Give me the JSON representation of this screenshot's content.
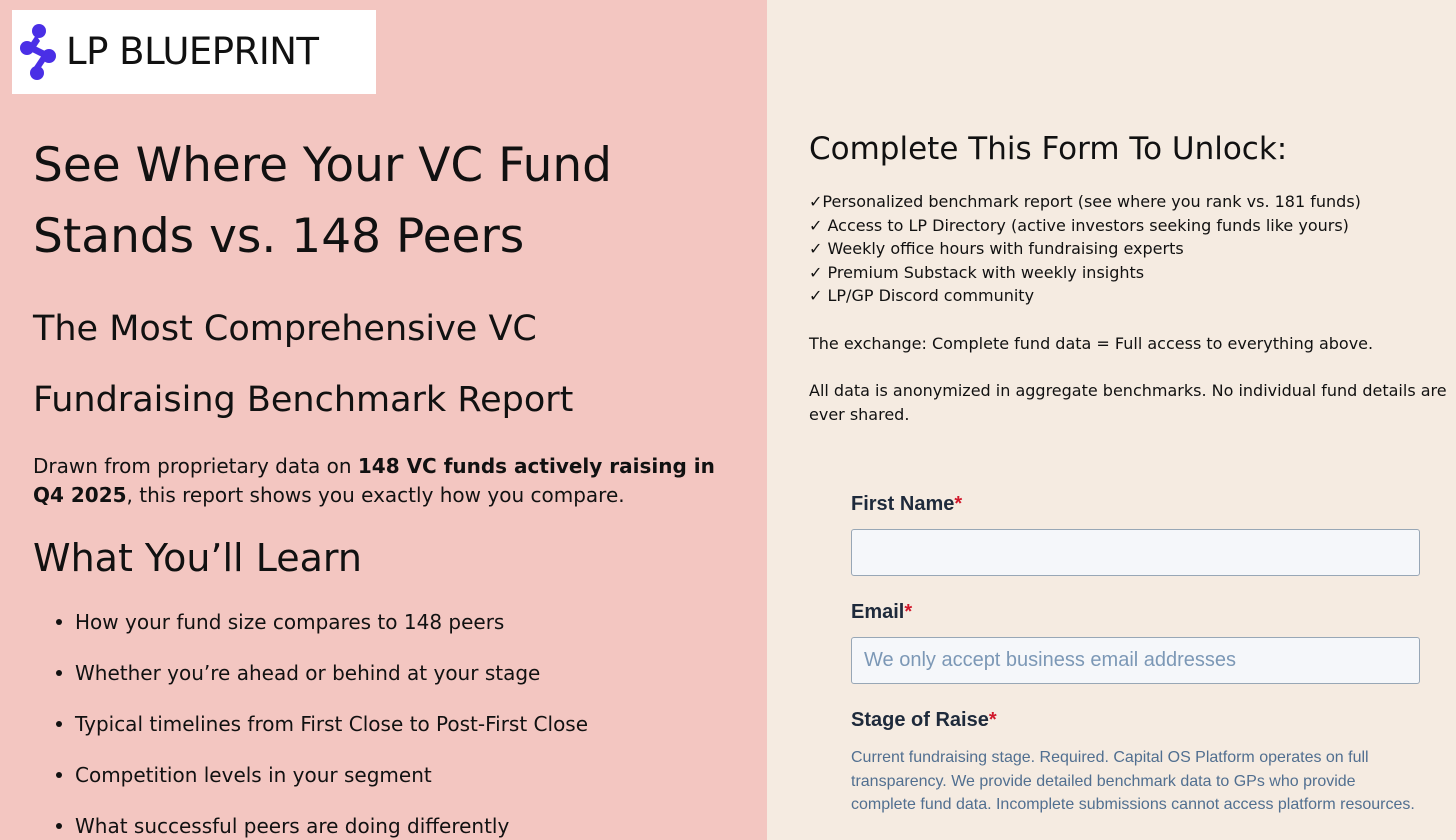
{
  "brand": {
    "name": "LP BLUEPRINT",
    "color": "#4a2fe6"
  },
  "left": {
    "title": "See Where Your VC Fund Stands vs. 148 Peers",
    "subtitle": "The Most Comprehensive VC Fundraising Benchmark Report",
    "intro_prefix": "Drawn from proprietary data on ",
    "intro_bold": "148 VC funds actively raising in Q4 2025",
    "intro_suffix": ", this report shows you exactly how you compare.",
    "learn_heading": "What You’ll Learn",
    "learn_items": [
      "How your fund size compares to 148 peers",
      "Whether you’re ahead or behind at your stage",
      "Typical timelines from First Close to Post-First Close",
      "Competition levels in your segment",
      "What successful peers are doing differently"
    ]
  },
  "right": {
    "heading": "Complete This Form To Unlock:",
    "benefits": [
      "✓Personalized benchmark report (see where you rank vs. 181 funds)",
      "✓ Access to LP Directory (active investors seeking funds like yours)",
      "✓ Weekly office hours with fundraising experts",
      "✓ Premium Substack with weekly insights",
      "✓ LP/GP Discord community"
    ],
    "exchange": "The exchange: Complete fund data = Full access to everything above.",
    "anonymized": "All data is anonymized in aggregate benchmarks. No individual fund details are ever shared."
  },
  "form": {
    "first_name_label": "First Name",
    "first_name_value": "",
    "email_label": "Email",
    "email_value": "",
    "email_placeholder": "We only accept business email addresses",
    "stage_label": "Stage of Raise",
    "stage_help": "Current fundraising stage. Required. Capital OS Platform operates on full transparency. We provide detailed benchmark data to GPs who provide complete fund data. Incomplete submissions cannot access platform resources.",
    "required_marker": "*"
  }
}
